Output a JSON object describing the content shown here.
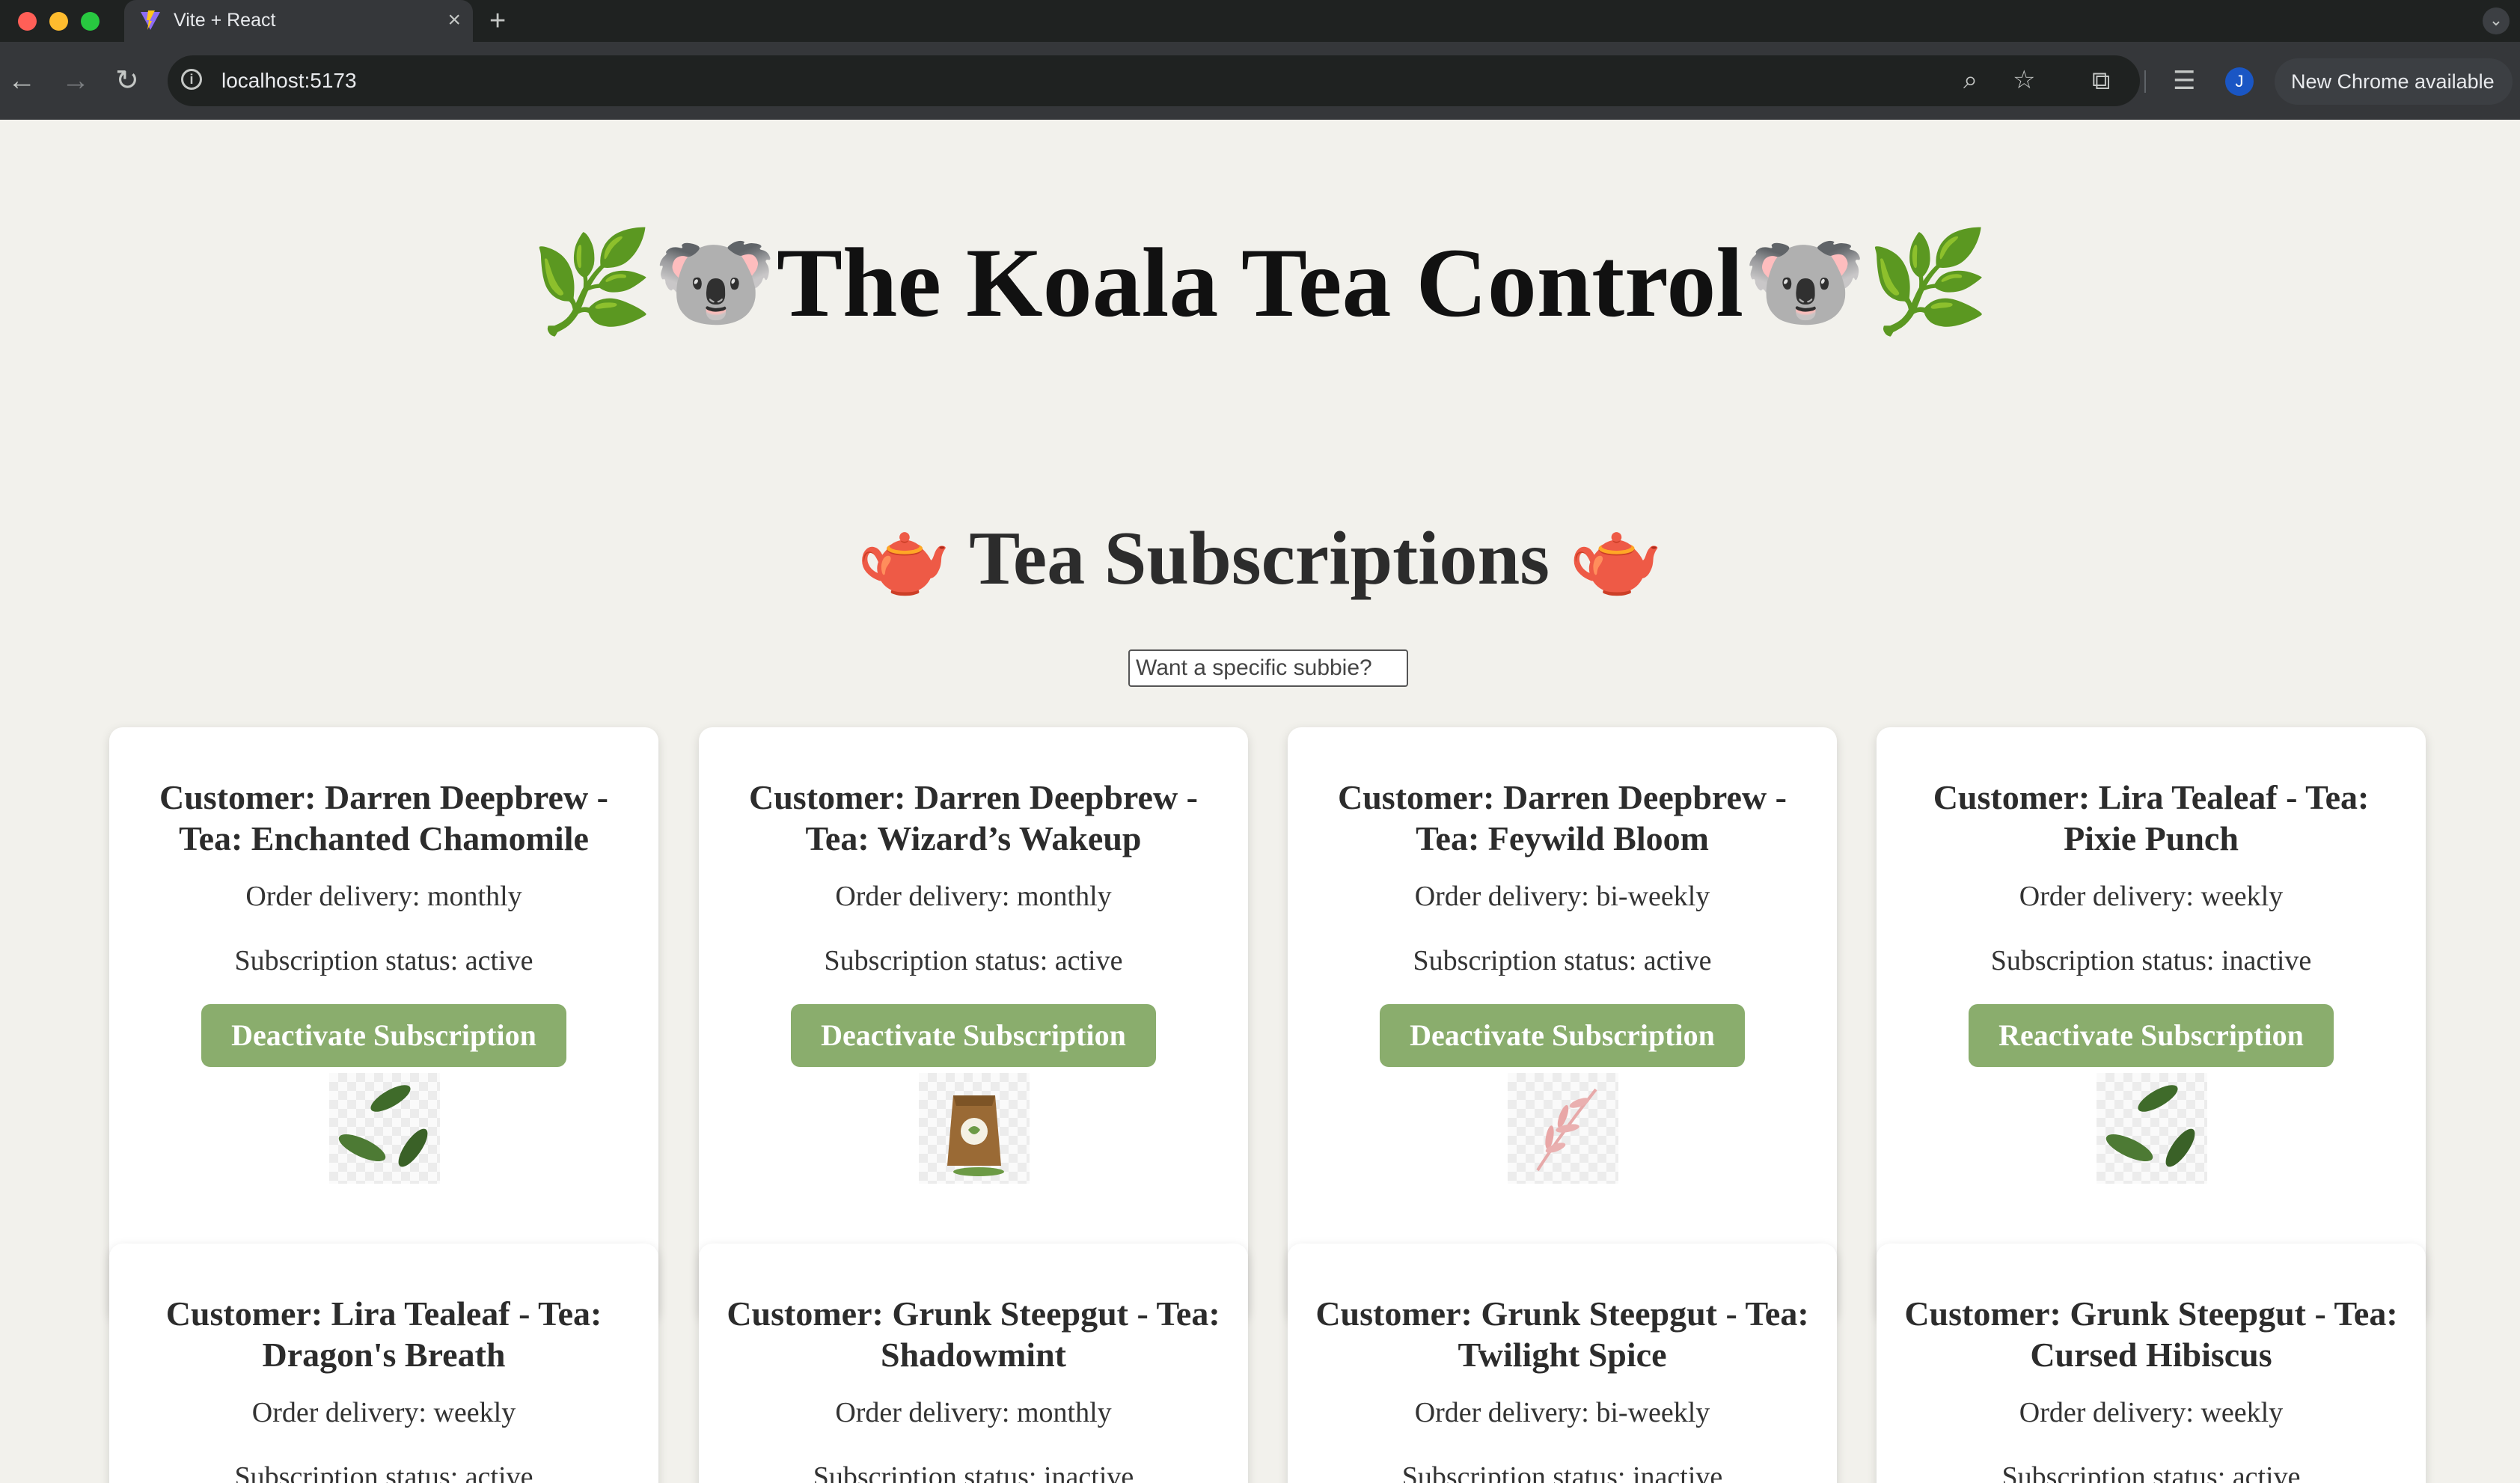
{
  "browser": {
    "tab_title": "Vite + React",
    "url": "localhost:5173",
    "profile_initial": "J",
    "update_label": "New Chrome available",
    "icons": [
      "back-icon",
      "forward-icon",
      "reload-icon",
      "site-info-icon",
      "zoom-icon",
      "bookmark-star-icon",
      "extensions-icon",
      "reading-list-icon",
      "kebab-menu-icon"
    ]
  },
  "page": {
    "title": "The Koala Tea Control",
    "title_emojis": [
      "🌿",
      "🐨"
    ],
    "section_title": "Tea Subscriptions",
    "section_emoji": "🫖",
    "search_placeholder": "Want a specific subbie?"
  },
  "colors": {
    "background": "#f2f1ec",
    "button": "#8aad6d",
    "button_text": "#ffffff",
    "card": "#ffffff"
  },
  "subscriptions": [
    {
      "title": "Customer: Darren Deepbrew - Tea: Enchanted Chamomile",
      "delivery": "Order delivery: monthly",
      "status": "Subscription status: active",
      "button": "Deactivate Subscription",
      "image": "tea-leaves-icon"
    },
    {
      "title": "Customer: Darren Deepbrew - Tea: Wizard’s Wakeup",
      "delivery": "Order delivery: monthly",
      "status": "Subscription status: active",
      "button": "Deactivate Subscription",
      "image": "tea-bag-icon"
    },
    {
      "title": "Customer: Darren Deepbrew - Tea: Feywild Bloom",
      "delivery": "Order delivery: bi-weekly",
      "status": "Subscription status: active",
      "button": "Deactivate Subscription",
      "image": "pink-sprig-icon"
    },
    {
      "title": "Customer: Lira Tealeaf - Tea: Pixie Punch",
      "delivery": "Order delivery: weekly",
      "status": "Subscription status: inactive",
      "button": "Reactivate Subscription",
      "image": "tea-leaves-icon"
    },
    {
      "title": "Customer: Lira Tealeaf - Tea: Dragon's Breath",
      "delivery": "Order delivery: weekly",
      "status": "Subscription status: active"
    },
    {
      "title": "Customer: Grunk Steepgut - Tea: Shadowmint",
      "delivery": "Order delivery: monthly",
      "status": "Subscription status: inactive"
    },
    {
      "title": "Customer: Grunk Steepgut - Tea: Twilight Spice",
      "delivery": "Order delivery: bi-weekly",
      "status": "Subscription status: inactive"
    },
    {
      "title": "Customer: Grunk Steepgut - Tea: Cursed Hibiscus",
      "delivery": "Order delivery: weekly",
      "status": "Subscription status: active"
    }
  ]
}
